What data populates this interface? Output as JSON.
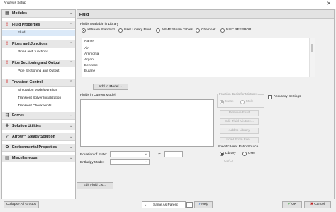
{
  "window": {
    "title": "Analysis Setup",
    "close_glyph": "✕"
  },
  "sidebar": {
    "groups": [
      {
        "label": "Modules",
        "icon": "modules-icon",
        "error": false,
        "children": []
      },
      {
        "label": "Fluid Properties",
        "icon": "error-icon",
        "error": true,
        "children": [
          {
            "label": "Fluid",
            "active": true
          }
        ]
      },
      {
        "label": "Pipes and Junctions",
        "icon": "error-icon",
        "error": true,
        "children": [
          {
            "label": "Pipes and Junctions",
            "active": false
          }
        ]
      },
      {
        "label": "Pipe Sectioning and Output",
        "icon": "error-icon",
        "error": true,
        "children": [
          {
            "label": "Pipe Sectioning and Output",
            "active": false
          }
        ]
      },
      {
        "label": "Transient Control",
        "icon": "error-icon",
        "error": true,
        "children": [
          {
            "label": "Simulation Mode/Duration",
            "active": false
          },
          {
            "label": "Transient Solver Initialization",
            "active": false
          },
          {
            "label": "Transient Checkpoints",
            "active": false
          }
        ]
      },
      {
        "label": "Forces",
        "icon": "forces-icon",
        "error": false,
        "children": []
      },
      {
        "label": "Solution Utilities",
        "icon": "solution-utilities-icon",
        "error": false,
        "children": []
      },
      {
        "label": "Arrow™ Steady Solution",
        "icon": "steady-solution-icon",
        "error": false,
        "children": []
      },
      {
        "label": "Environmental Properties",
        "icon": "environmental-icon",
        "error": false,
        "children": []
      },
      {
        "label": "Miscellaneous",
        "icon": "miscellaneous-icon",
        "error": false,
        "children": []
      }
    ]
  },
  "main": {
    "header": "Fluid",
    "library_label": "Fluids Available in Library",
    "library_options": [
      {
        "label": "xStream Standard",
        "selected": true
      },
      {
        "label": "User Library Fluid",
        "selected": false
      },
      {
        "label": "ASME Steam Tables",
        "selected": false
      },
      {
        "label": "Chempak",
        "selected": false
      },
      {
        "label": "NIST REFPROP",
        "selected": false
      }
    ],
    "library_column_header": "Name",
    "library_fluids": [
      "Air",
      "Ammonia",
      "Argon",
      "Benzene",
      "Butane"
    ],
    "add_to_model_label": "Add to Model",
    "current_model_label": "Fluids in Current Model",
    "fraction_basis_label": "Fraction Basis for Mixtures",
    "fraction_options": [
      {
        "label": "Mass",
        "selected": true
      },
      {
        "label": "Mole",
        "selected": false
      }
    ],
    "accuracy_settings_label": "Accuracy Settings",
    "buttons": {
      "remove_fluid": "Remove Fluid",
      "edit_fluid_mixture": "Edit Fluid Mixture...",
      "add_to_library": "Add to Library",
      "load_from_file": "Load From File..."
    },
    "specific_heat_label": "Specific Heat Ratio Source",
    "specific_heat_options": [
      {
        "label": "Library",
        "selected": true
      },
      {
        "label": "User",
        "selected": false
      }
    ],
    "cp_cv_label": "Cp/Cv",
    "equation_of_state_label": "Equation of State:",
    "enthalpy_model_label": "Enthalpy Model:",
    "z_label": "Z:",
    "edit_fluid_list_label": "Edit Fluid List..."
  },
  "footer": {
    "collapse_all_label": "Collapse All Groups",
    "same_as_parent_label": "Same As Parent",
    "help_label": "Help",
    "ok_label": "OK",
    "cancel_label": "Cancel"
  }
}
